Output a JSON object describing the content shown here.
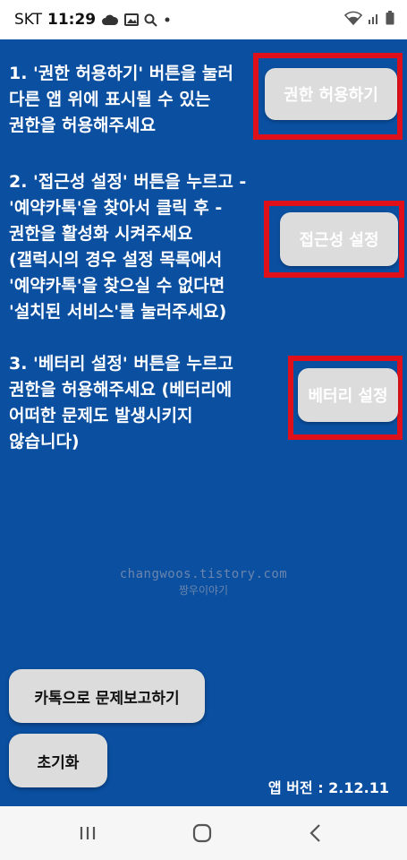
{
  "status_bar": {
    "carrier": "SKT",
    "time": "11:29"
  },
  "steps": [
    {
      "lines": [
        "1. '권한 허용하기' 버튼을 눌러",
        "다른 앱 위에 표시될 수 있는",
        "권한을 허용해주세요"
      ],
      "button_label": "권한 허용하기"
    },
    {
      "lines": [
        "2. '접근성 설정' 버튼을 누르고 -",
        "'예약카톡'을 찾아서 클릭 후 -",
        "권한을 활성화 시켜주세요",
        "(갤럭시의 경우 설정 목록에서",
        "'예약카톡'을 찾으실 수 없다면",
        "'설치된 서비스'를 눌러주세요)"
      ],
      "button_label": "접근성 설정"
    },
    {
      "lines": [
        "3. '베터리 설정' 버튼을 누르고",
        "권한을 허용해주세요 (베터리에",
        "어떠한 문제도 발생시키지",
        "않습니다)"
      ],
      "button_label": "베터리 설정"
    }
  ],
  "watermark": {
    "url": "changwoos.tistory.com",
    "name": "짱우이야기"
  },
  "bottom_buttons": {
    "report": "카톡으로 문제보고하기",
    "reset": "초기화"
  },
  "version_label": "앱 버전 : 2.12.11",
  "colors": {
    "background": "#0a4fa0",
    "highlight": "#e0101a",
    "button": "#dcdcdc"
  },
  "icons": [
    "cloud-icon",
    "gallery-icon",
    "search-icon",
    "dot-icon",
    "wifi-icon",
    "signal-icon",
    "battery-icon",
    "recent-apps-icon",
    "home-icon",
    "back-icon"
  ]
}
